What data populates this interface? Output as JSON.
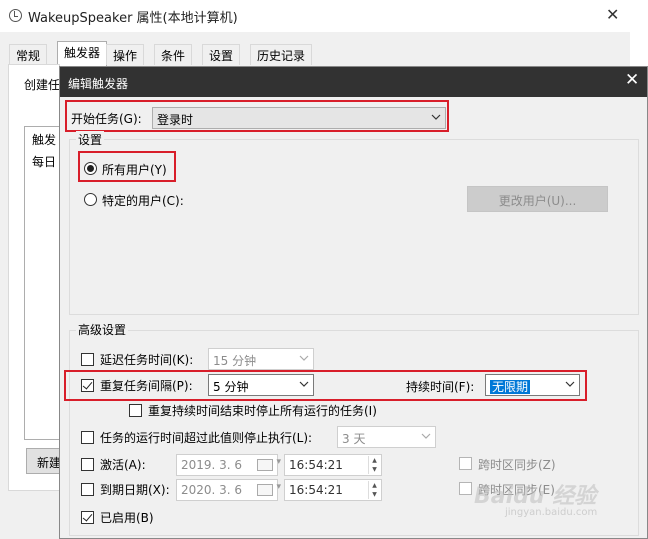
{
  "background_window": {
    "title": "WakeupSpeaker 属性(本地计算机)",
    "tabs": [
      "常规",
      "触发器",
      "操作",
      "条件",
      "设置",
      "历史记录"
    ],
    "active_tab": "触发器",
    "create_label": "创建任",
    "list_header": "触发",
    "list_row": "每日",
    "new_button": "新建"
  },
  "dialog": {
    "title": "编辑触发器",
    "begin_task_label": "开始任务(G):",
    "begin_task_value": "登录时",
    "settings_title": "设置",
    "all_users_label": "所有用户(Y)",
    "specific_user_label": "特定的用户(C):",
    "change_user_button": "更改用户(U)...",
    "advanced_title": "高级设置",
    "delay_label": "延迟任务时间(K):",
    "delay_value": "15 分钟",
    "repeat_label": "重复任务间隔(P):",
    "repeat_value": "5 分钟",
    "duration_label": "持续时间(F):",
    "duration_value": "无限期",
    "stop_all_label": "重复持续时间结束时停止所有运行的任务(I)",
    "stop_exceed_label": "任务的运行时间超过此值则停止执行(L):",
    "stop_exceed_value": "3 天",
    "activate_label": "激活(A):",
    "activate_date": "2019. 3. 6",
    "activate_time": "16:54:21",
    "sync_tz_1": "跨时区同步(Z)",
    "expire_label": "到期日期(X):",
    "expire_date": "2020. 3. 6",
    "expire_time": "16:54:21",
    "sync_tz_2": "跨时区同步(E)",
    "enabled_label": "已启用(B)"
  },
  "watermark": {
    "logo": "Baidu 经验",
    "sub": "jingyan.baidu.com"
  },
  "state": {
    "all_users": true,
    "delay_checked": false,
    "repeat_checked": true,
    "stop_all_checked": false,
    "stop_exceed_checked": false,
    "activate_checked": false,
    "expire_checked": false,
    "enabled_checked": true
  },
  "colors": {
    "highlight_box": "#d81e2a",
    "dialog_title_bg": "#323232",
    "selection": "#0078d7"
  }
}
